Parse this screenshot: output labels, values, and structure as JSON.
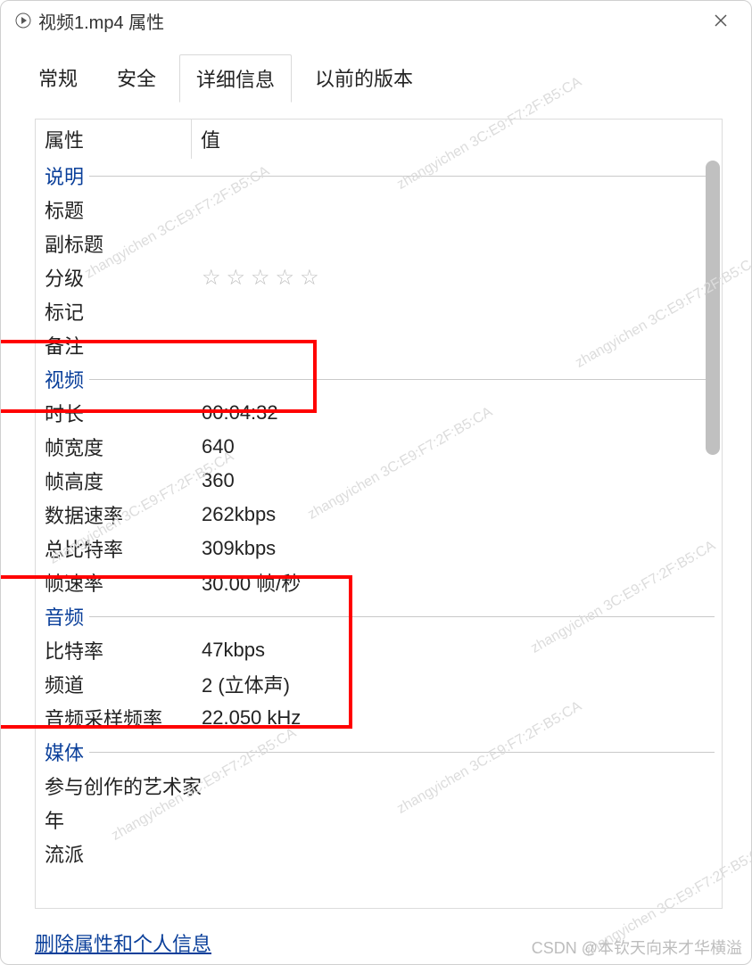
{
  "window": {
    "title": "视频1.mp4 属性"
  },
  "tabs": {
    "general": "常规",
    "security": "安全",
    "details": "详细信息",
    "previous": "以前的版本"
  },
  "headers": {
    "property": "属性",
    "value": "值"
  },
  "sections": {
    "description": "说明",
    "video": "视频",
    "audio": "音频",
    "media": "媒体"
  },
  "desc": {
    "title_lbl": "标题",
    "title_val": "",
    "subtitle_lbl": "副标题",
    "subtitle_val": "",
    "rating_lbl": "分级",
    "tags_lbl": "标记",
    "tags_val": "",
    "comments_lbl": "备注",
    "comments_val": ""
  },
  "video": {
    "length_lbl": "时长",
    "length_val": "00:04:32",
    "width_lbl": "帧宽度",
    "width_val": "640",
    "height_lbl": "帧高度",
    "height_val": "360",
    "datarate_lbl": "数据速率",
    "datarate_val": "262kbps",
    "totalbr_lbl": "总比特率",
    "totalbr_val": "309kbps",
    "framerate_lbl": "帧速率",
    "framerate_val": "30.00 帧/秒"
  },
  "audio": {
    "bitrate_lbl": "比特率",
    "bitrate_val": "47kbps",
    "channels_lbl": "频道",
    "channels_val": "2 (立体声)",
    "samplerate_lbl": "音频采样频率",
    "samplerate_val": "22.050 kHz"
  },
  "media": {
    "artist_lbl": "参与创作的艺术家",
    "artist_val": "",
    "year_lbl": "年",
    "year_val": "",
    "genre_lbl": "流派",
    "genre_val": ""
  },
  "link": {
    "remove": "删除属性和个人信息"
  },
  "watermark": "zhangyichen 3C:E9:F7:2F:B5:CA",
  "csdn": "CSDN @本钦天向来才华横溢"
}
